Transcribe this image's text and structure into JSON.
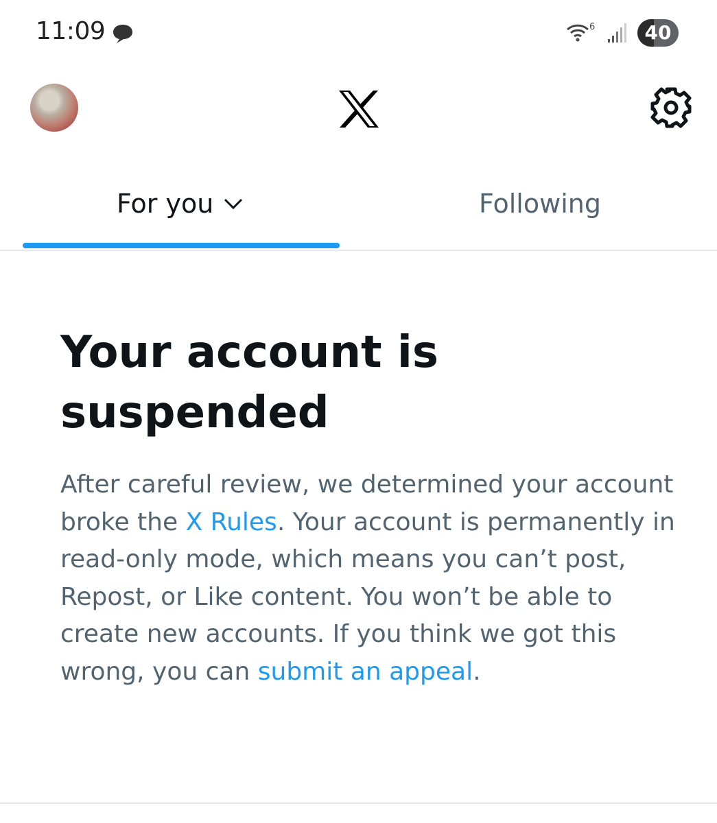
{
  "status_bar": {
    "time": "11:09",
    "wifi_badge": "6",
    "battery": "40"
  },
  "header": {
    "logo": "X",
    "settings_icon": "gear-icon"
  },
  "tabs": [
    {
      "label": "For you",
      "active": true
    },
    {
      "label": "Following",
      "active": false
    }
  ],
  "suspension": {
    "title": "Your account is suspended",
    "body_1": "After careful review, we determined your account broke the ",
    "rules_link": "X Rules",
    "body_2": ". Your account is permanently in read-only mode, which means you can’t post, Repost, or Like content. You won’t be able to create new accounts. If you think we got this wrong, you can ",
    "appeal_link": "submit an appeal",
    "body_3": "."
  },
  "colors": {
    "accent": "#1d9bf0",
    "text_primary": "#0f1419",
    "text_secondary": "#536471",
    "divider": "#e3e6ea"
  }
}
